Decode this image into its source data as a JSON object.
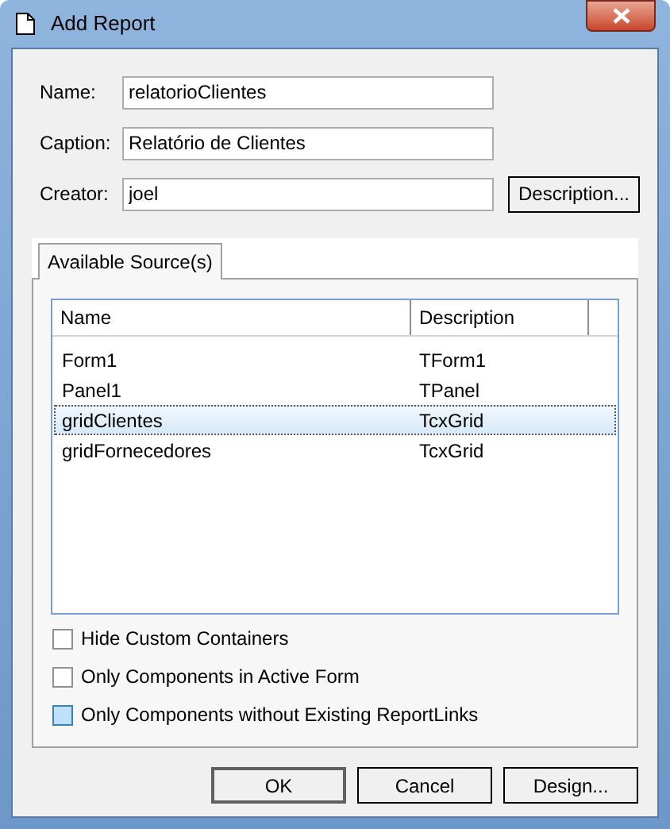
{
  "window": {
    "title": "Add Report"
  },
  "fields": [
    {
      "label": "Name:",
      "value": "relatorioClientes"
    },
    {
      "label": "Caption:",
      "value": "Relatório de Clientes"
    },
    {
      "label": "Creator:",
      "value": "joel"
    }
  ],
  "description_button": "Description...",
  "tabs": [
    {
      "label": "Available Source(s)",
      "selected": true
    }
  ],
  "table": {
    "columns": [
      "Name",
      "Description"
    ],
    "rows": [
      {
        "cells": [
          "Form1",
          "TForm1"
        ],
        "selected": false
      },
      {
        "cells": [
          "Panel1",
          "TPanel"
        ],
        "selected": false
      },
      {
        "cells": [
          "gridClientes",
          "TcxGrid"
        ],
        "selected": true
      },
      {
        "cells": [
          "gridFornecedores",
          "TcxGrid"
        ],
        "selected": false
      }
    ]
  },
  "options": [
    {
      "label": "Hide Custom Containers",
      "checked": false,
      "hovered": false
    },
    {
      "label": "Only Components in Active Form",
      "checked": false,
      "hovered": false
    },
    {
      "label": "Only Components without Existing ReportLinks",
      "checked": false,
      "hovered": true
    }
  ],
  "buttons": [
    {
      "label": "OK",
      "default": true
    },
    {
      "label": "Cancel",
      "default": false
    },
    {
      "label": "Design...",
      "default": false
    }
  ]
}
